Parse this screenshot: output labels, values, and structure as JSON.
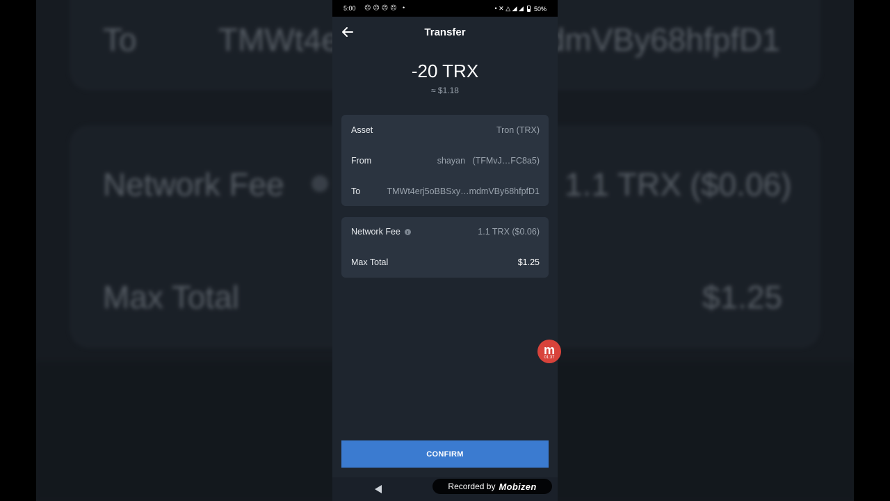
{
  "background": {
    "to_label": "To",
    "to_value": "TMWt4erj5oBBSxy…mdmVBy68hfpfD1",
    "fee_label": "Network Fee",
    "fee_value": "1.1 TRX ($0.06)",
    "total_label": "Max Total",
    "total_value": "$1.25"
  },
  "status_bar": {
    "time": "5:00",
    "left_icons": "☹☹☹☹ •",
    "right_icons": "• ✕ △ ◢ ◢",
    "battery": "50%"
  },
  "header": {
    "title": "Transfer"
  },
  "summary": {
    "amount": "-20 TRX",
    "fiat": "≈ $1.18"
  },
  "details": {
    "asset_label": "Asset",
    "asset_value": "Tron (TRX)",
    "from_label": "From",
    "from_value": "shayan   (TFMvJ…FC8a5)",
    "to_label": "To",
    "to_value": "TMWt4erj5oBBSxy…mdmVBy68hfpfD1"
  },
  "fees": {
    "fee_label": "Network Fee",
    "fee_value": "1.1 TRX ($0.06)",
    "total_label": "Max Total",
    "total_value": "$1.25"
  },
  "confirm_label": "CONFIRM",
  "recorder": {
    "badge_letter": "m",
    "badge_time": "01:37",
    "watermark_text": "Recorded by",
    "watermark_brand": "Mobizen"
  },
  "colors": {
    "accent": "#3b7bd0",
    "surface": "#1e252e",
    "card": "#2b3440",
    "recorder": "#d8433b"
  }
}
